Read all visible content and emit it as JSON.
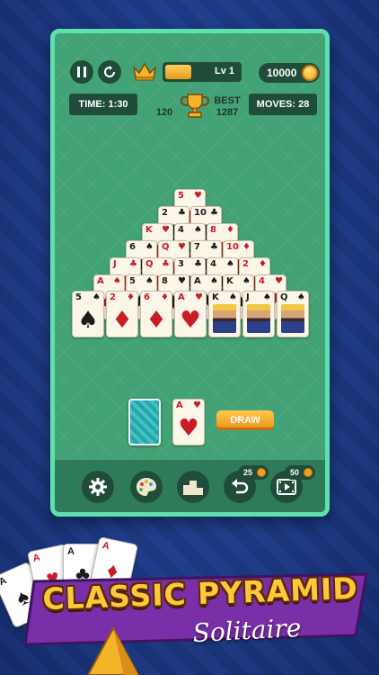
{
  "game": {
    "level_label": "Lv 1",
    "level_progress": 0.35,
    "coins": "10000",
    "time_label": "TIME: 1:30",
    "moves_label": "MOVES: 28",
    "score": "120",
    "best_label": "BEST",
    "best_value": "1287",
    "draw_label": "DRAW",
    "hint_cost": "25",
    "video_cost": "50"
  },
  "pyramid": [
    {
      "rank": "5",
      "suit": "♥",
      "color": "red"
    },
    {
      "rank": "2",
      "suit": "♣",
      "color": "black"
    },
    {
      "rank": "10",
      "suit": "♣",
      "color": "black"
    },
    {
      "rank": "K",
      "suit": "♥",
      "color": "red"
    },
    {
      "rank": "4",
      "suit": "♠",
      "color": "black"
    },
    {
      "rank": "8",
      "suit": "♦",
      "color": "red"
    },
    {
      "rank": "6",
      "suit": "♠",
      "color": "black"
    },
    {
      "rank": "Q",
      "suit": "♥",
      "color": "red"
    },
    {
      "rank": "7",
      "suit": "♣",
      "color": "black"
    },
    {
      "rank": "10",
      "suit": "♦",
      "color": "red"
    },
    {
      "rank": "J",
      "suit": "♣",
      "color": "red"
    },
    {
      "rank": "Q",
      "suit": "♣",
      "color": "red"
    },
    {
      "rank": "3",
      "suit": "♣",
      "color": "black"
    },
    {
      "rank": "4",
      "suit": "♠",
      "color": "black"
    },
    {
      "rank": "2",
      "suit": "♦",
      "color": "red"
    },
    {
      "rank": "A",
      "suit": "♠",
      "color": "red"
    },
    {
      "rank": "5",
      "suit": "♠",
      "color": "black"
    },
    {
      "rank": "8",
      "suit": "♥",
      "color": "black"
    },
    {
      "rank": "A",
      "suit": "♠",
      "color": "black"
    },
    {
      "rank": "K",
      "suit": "♠",
      "color": "black"
    },
    {
      "rank": "4",
      "suit": "♥",
      "color": "red"
    }
  ],
  "bottom_row": [
    {
      "rank": "5",
      "suit": "♠",
      "color": "black",
      "face": false
    },
    {
      "rank": "2",
      "suit": "♦",
      "color": "red",
      "face": false
    },
    {
      "rank": "6",
      "suit": "♦",
      "color": "red",
      "face": false
    },
    {
      "rank": "A",
      "suit": "♥",
      "color": "red",
      "face": false
    },
    {
      "rank": "K",
      "suit": "♠",
      "color": "black",
      "face": true
    },
    {
      "rank": "J",
      "suit": "♠",
      "color": "black",
      "face": true
    },
    {
      "rank": "Q",
      "suit": "♠",
      "color": "black",
      "face": true
    }
  ],
  "waste": {
    "rank": "A",
    "suit": "♥",
    "color": "red"
  },
  "banner": {
    "title": "CLASSIC PYRAMID",
    "subtitle": "Solitaire"
  },
  "fan_cards": [
    {
      "rank": "A",
      "suit": "♠"
    },
    {
      "rank": "A",
      "suit": "♥"
    },
    {
      "rank": "A",
      "suit": "♣"
    },
    {
      "rank": "A",
      "suit": "♦"
    }
  ],
  "colors": {
    "felt": "#43a275",
    "frame": "#5fe0b0",
    "panel": "#1f4d39",
    "accent": "#f0a020",
    "background": "#23459a"
  },
  "icons": [
    "pause-icon",
    "restart-icon",
    "crown-icon",
    "coin-icon",
    "trophy-icon",
    "gear-icon",
    "palette-icon",
    "podium-icon",
    "undo-icon",
    "video-icon"
  ]
}
